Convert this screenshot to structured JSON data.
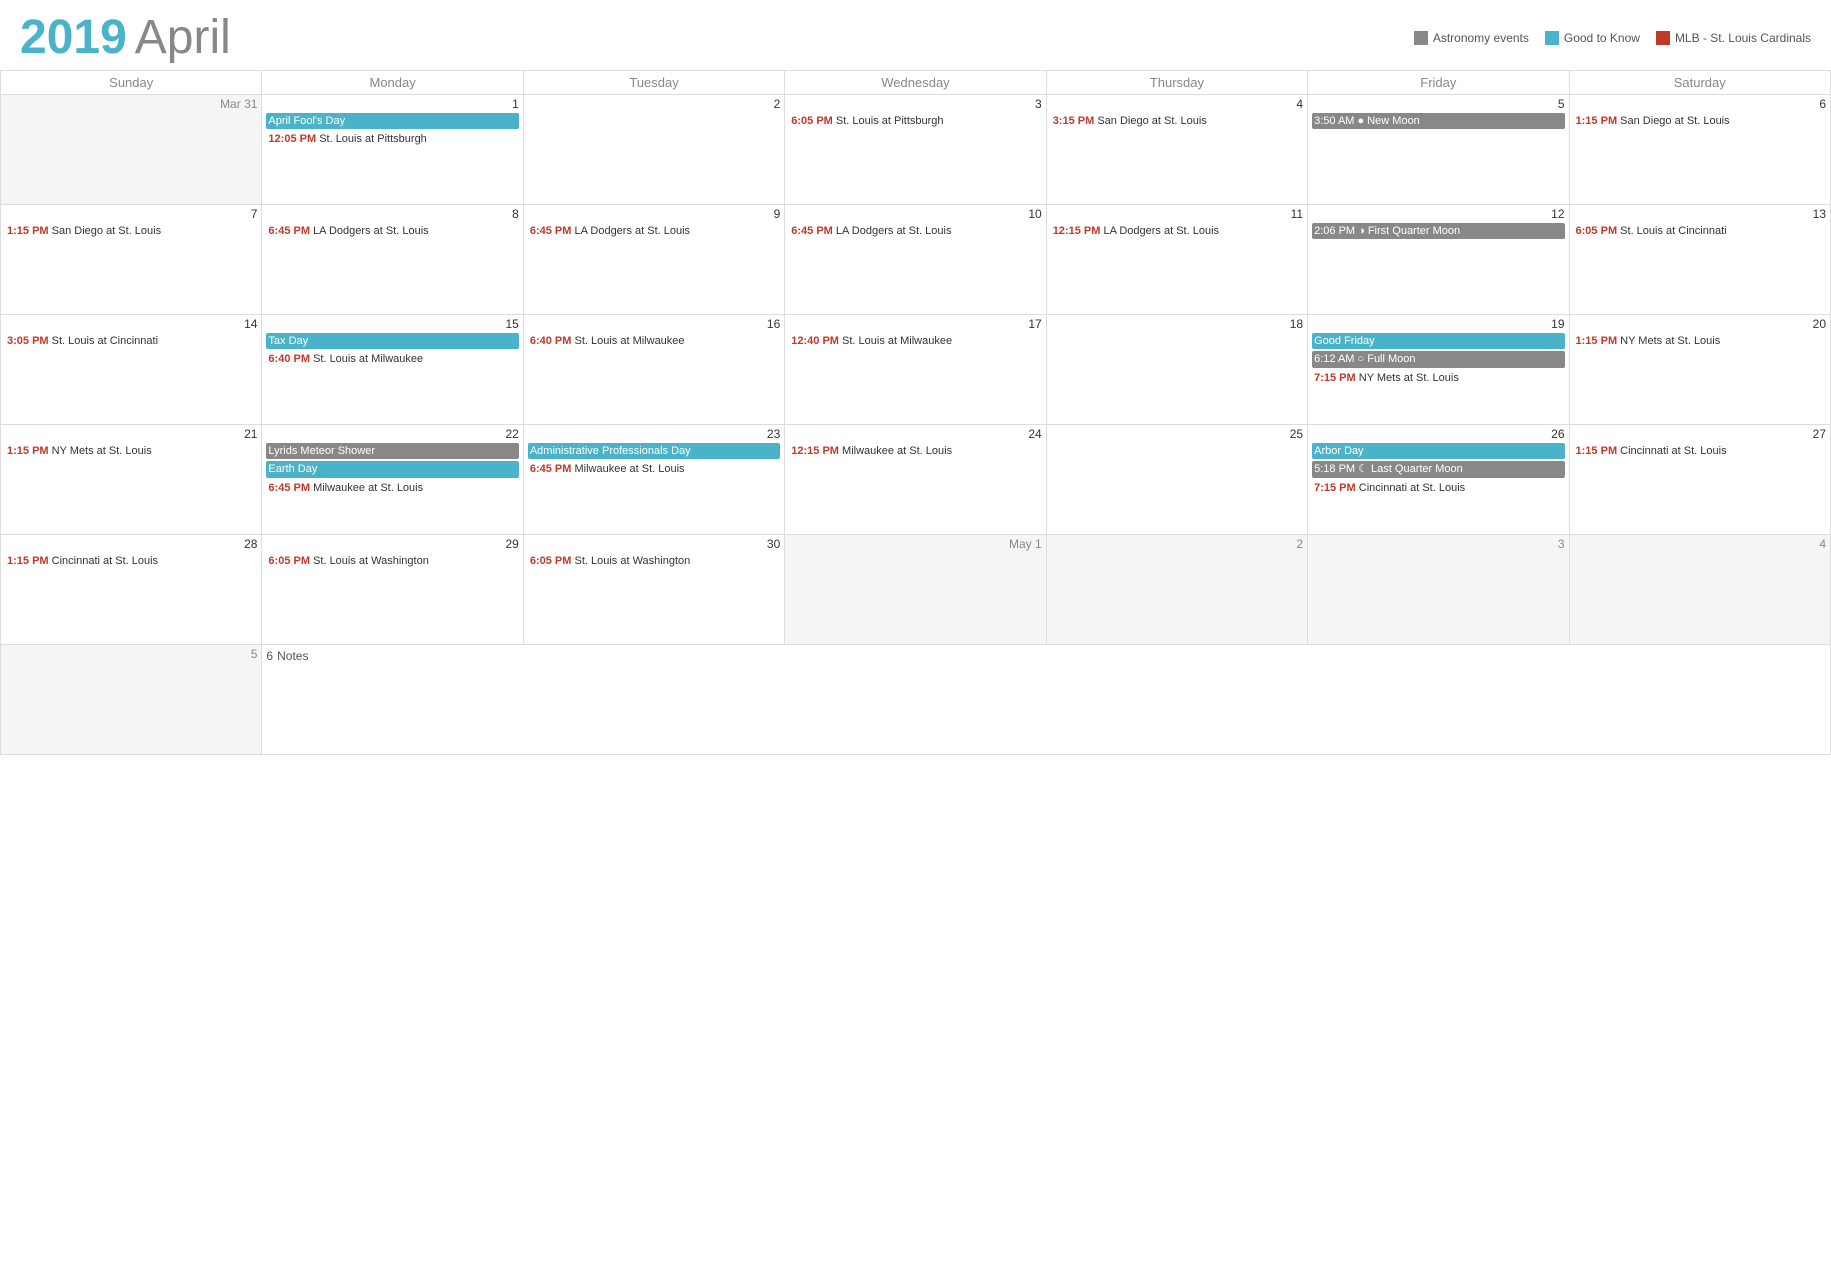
{
  "header": {
    "year": "2019",
    "month": "April"
  },
  "legend": [
    {
      "id": "astronomy",
      "label": "Astronomy events",
      "color": "#888888"
    },
    {
      "id": "goodtoknow",
      "label": "Good to Know",
      "color": "#4ab3c9"
    },
    {
      "id": "mlb",
      "label": "MLB - St. Louis Cardinals",
      "color": "#c0392b"
    }
  ],
  "days_of_week": [
    "Sunday",
    "Monday",
    "Tuesday",
    "Wednesday",
    "Thursday",
    "Friday",
    "Saturday"
  ],
  "weeks": [
    {
      "days": [
        {
          "date": "Mar 31",
          "other": true,
          "events": []
        },
        {
          "date": "1",
          "events": [
            {
              "type": "teal",
              "text": "April Fool's Day"
            },
            {
              "type": "mlb",
              "time": "12:05 PM",
              "game": "St. Louis at Pittsburgh"
            }
          ]
        },
        {
          "date": "2",
          "events": []
        },
        {
          "date": "3",
          "events": [
            {
              "type": "mlb",
              "time": "6:05 PM",
              "game": "St. Louis at Pittsburgh"
            }
          ]
        },
        {
          "date": "4",
          "events": [
            {
              "type": "mlb",
              "time": "3:15 PM",
              "game": "San Diego at St. Louis"
            }
          ]
        },
        {
          "date": "5",
          "events": [
            {
              "type": "gray",
              "text": "3:50 AM ● New Moon"
            }
          ]
        },
        {
          "date": "6",
          "events": [
            {
              "type": "mlb",
              "time": "1:15 PM",
              "game": "San Diego at St. Louis"
            }
          ]
        }
      ]
    },
    {
      "days": [
        {
          "date": "7",
          "events": [
            {
              "type": "mlb",
              "time": "1:15 PM",
              "game": "San Diego at St. Louis"
            }
          ]
        },
        {
          "date": "8",
          "events": [
            {
              "type": "mlb",
              "time": "6:45 PM",
              "game": "LA Dodgers at St. Louis"
            }
          ]
        },
        {
          "date": "9",
          "events": [
            {
              "type": "mlb",
              "time": "6:45 PM",
              "game": "LA Dodgers at St. Louis"
            }
          ]
        },
        {
          "date": "10",
          "events": [
            {
              "type": "mlb",
              "time": "6:45 PM",
              "game": "LA Dodgers at St. Louis"
            }
          ]
        },
        {
          "date": "11",
          "events": [
            {
              "type": "mlb",
              "time": "12:15 PM",
              "game": "LA Dodgers at St. Louis"
            }
          ]
        },
        {
          "date": "12",
          "events": [
            {
              "type": "gray",
              "text": "2:06 PM ◑ First Quarter Moon"
            }
          ]
        },
        {
          "date": "13",
          "events": [
            {
              "type": "mlb",
              "time": "6:05 PM",
              "game": "St. Louis at Cincinnati"
            }
          ]
        }
      ]
    },
    {
      "days": [
        {
          "date": "14",
          "events": [
            {
              "type": "mlb",
              "time": "3:05 PM",
              "game": "St. Louis at Cincinnati"
            }
          ]
        },
        {
          "date": "15",
          "events": [
            {
              "type": "teal",
              "text": "Tax Day"
            },
            {
              "type": "mlb",
              "time": "6:40 PM",
              "game": "St. Louis at Milwaukee"
            }
          ]
        },
        {
          "date": "16",
          "events": [
            {
              "type": "mlb",
              "time": "6:40 PM",
              "game": "St. Louis at Milwaukee"
            }
          ]
        },
        {
          "date": "17",
          "events": [
            {
              "type": "mlb",
              "time": "12:40 PM",
              "game": "St. Louis at Milwaukee"
            }
          ]
        },
        {
          "date": "18",
          "events": []
        },
        {
          "date": "19",
          "events": [
            {
              "type": "teal",
              "text": "Good Friday"
            },
            {
              "type": "gray",
              "text": "6:12 AM ○ Full Moon"
            },
            {
              "type": "mlb",
              "time": "7:15 PM",
              "game": "NY Mets at St. Louis"
            }
          ]
        },
        {
          "date": "20",
          "events": [
            {
              "type": "mlb",
              "time": "1:15 PM",
              "game": "NY Mets at St. Louis"
            }
          ]
        }
      ]
    },
    {
      "days": [
        {
          "date": "21",
          "events": [
            {
              "type": "mlb",
              "time": "1:15 PM",
              "game": "NY Mets at St. Louis"
            }
          ]
        },
        {
          "date": "22",
          "events": [
            {
              "type": "gray",
              "text": "Lyrids Meteor Shower"
            },
            {
              "type": "teal",
              "text": "Earth Day"
            },
            {
              "type": "mlb",
              "time": "6:45 PM",
              "game": "Milwaukee at St. Louis"
            }
          ]
        },
        {
          "date": "23",
          "events": [
            {
              "type": "teal",
              "text": "Administrative Professionals Day"
            },
            {
              "type": "mlb",
              "time": "6:45 PM",
              "game": "Milwaukee at St. Louis"
            }
          ]
        },
        {
          "date": "24",
          "events": [
            {
              "type": "mlb",
              "time": "12:15 PM",
              "game": "Milwaukee at St. Louis"
            }
          ]
        },
        {
          "date": "25",
          "events": []
        },
        {
          "date": "26",
          "events": [
            {
              "type": "teal",
              "text": "Arbor Day"
            },
            {
              "type": "gray",
              "text": "5:18 PM ☾ Last Quarter Moon"
            },
            {
              "type": "mlb",
              "time": "7:15 PM",
              "game": "Cincinnati at St. Louis"
            }
          ]
        },
        {
          "date": "27",
          "events": [
            {
              "type": "mlb",
              "time": "1:15 PM",
              "game": "Cincinnati at St. Louis"
            }
          ]
        }
      ]
    },
    {
      "days": [
        {
          "date": "28",
          "events": [
            {
              "type": "mlb",
              "time": "1:15 PM",
              "game": "Cincinnati at St. Louis"
            }
          ]
        },
        {
          "date": "29",
          "events": [
            {
              "type": "mlb",
              "time": "6:05 PM",
              "game": "St. Louis at Washington"
            }
          ]
        },
        {
          "date": "30",
          "events": [
            {
              "type": "mlb",
              "time": "6:05 PM",
              "game": "St. Louis at Washington"
            }
          ]
        },
        {
          "date": "May 1",
          "other": true,
          "events": []
        },
        {
          "date": "2",
          "other": true,
          "events": []
        },
        {
          "date": "3",
          "other": true,
          "events": []
        },
        {
          "date": "4",
          "other": true,
          "events": []
        }
      ]
    }
  ],
  "bottom_row": {
    "days": [
      {
        "date": "5",
        "other": true
      },
      {
        "date": "6",
        "notes": true
      },
      {
        "colspan": 5
      }
    ]
  },
  "notes_label": "Notes"
}
